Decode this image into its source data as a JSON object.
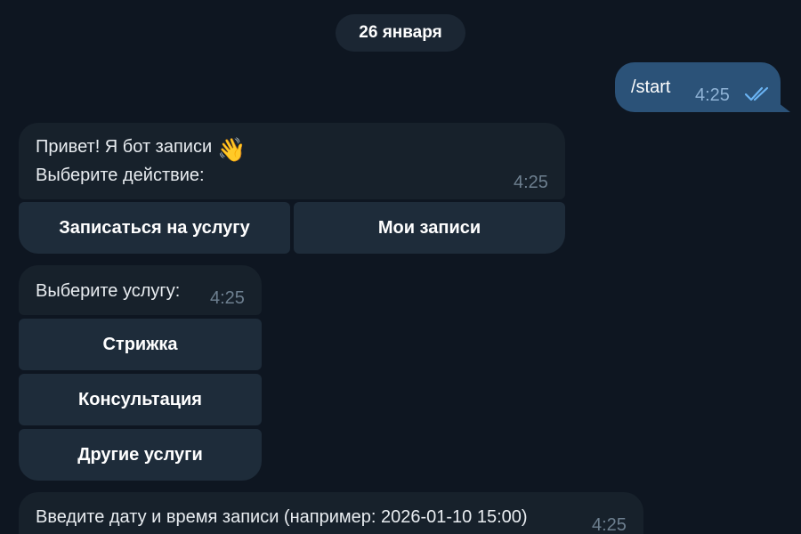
{
  "date_separator": "26 января",
  "outgoing": {
    "text": "/start",
    "time": "4:25",
    "status_icon": "double-check-icon"
  },
  "messages": [
    {
      "lines": [
        "Привет! Я бот записи",
        "Выберите действие:"
      ],
      "emoji": "👋",
      "time": "4:25",
      "buttons": [
        "Записаться на услугу",
        "Мои записи"
      ]
    },
    {
      "lines": [
        "Выберите услугу:"
      ],
      "time": "4:25",
      "buttons": [
        "Стрижка",
        "Консультация",
        "Другие услуги"
      ]
    },
    {
      "lines": [
        "Введите дату и время записи (например: 2026-01-10 15:00)"
      ],
      "time": "4:25"
    }
  ],
  "colors": {
    "background": "#0e1621",
    "incoming_bubble": "#17212b",
    "outgoing_bubble": "#2b5278",
    "inline_button": "#1e2c3a",
    "check_color": "#6ab3f3"
  }
}
